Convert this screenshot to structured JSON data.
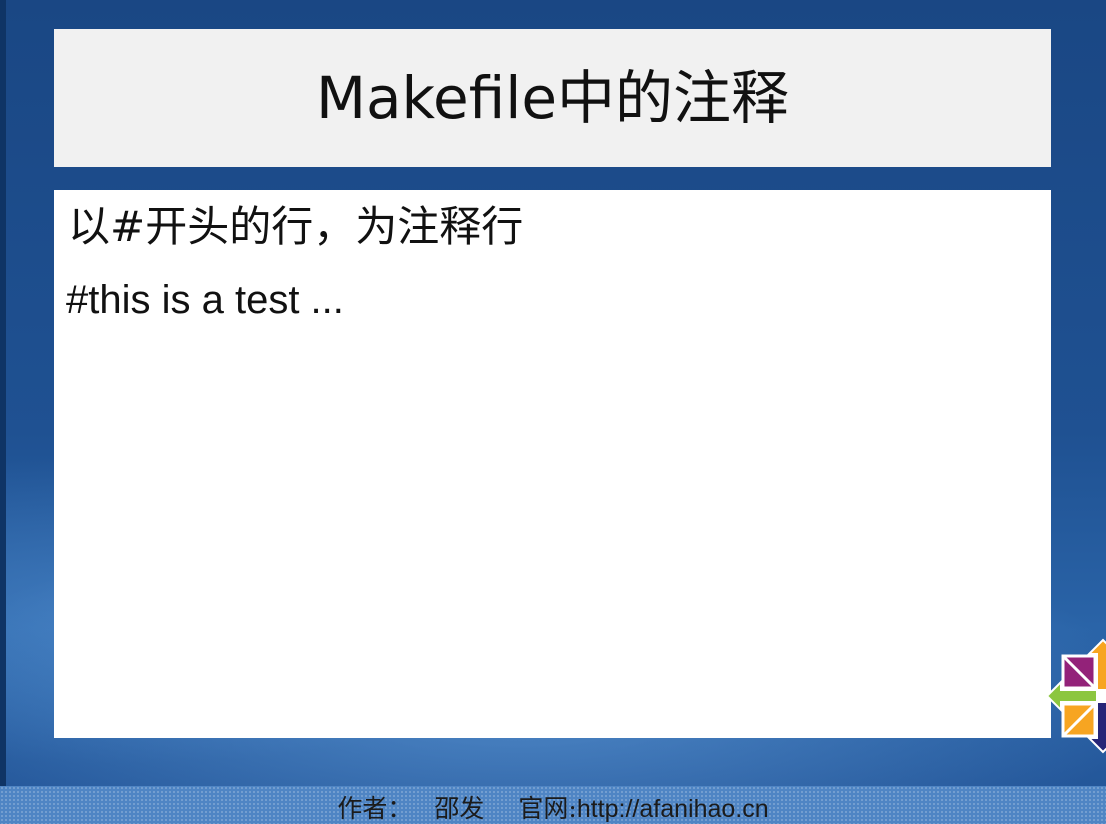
{
  "slide": {
    "title": "Makefile中的注释",
    "lines": [
      "以#开头的行，为注释行",
      "#this is a test ..."
    ]
  },
  "footer": {
    "author_label": "作者：",
    "author_name": "邵发",
    "site_label": "官网:",
    "site_url": "http://afanihao.cn"
  },
  "colors": {
    "background": "#1f4f8c",
    "title_box": "#f1f1f1",
    "content_box": "#ffffff",
    "footer_band": "#4f85c4",
    "logo_green": "#8cc63f",
    "logo_orange": "#f7a521",
    "logo_purple": "#932279",
    "logo_blue": "#262577"
  },
  "icons": {
    "corner_logo": "centos-logo-icon"
  }
}
